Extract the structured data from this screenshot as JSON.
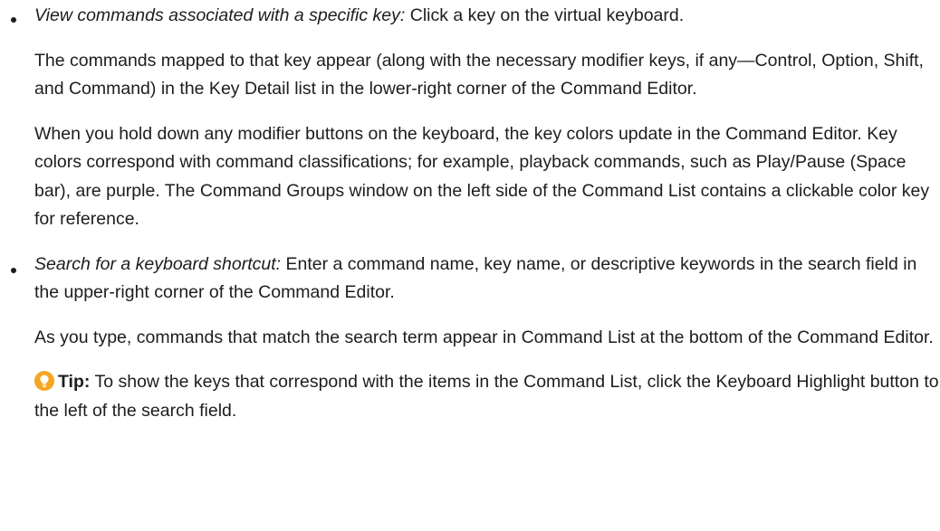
{
  "items": [
    {
      "term": "View commands associated with a specific key:",
      "lead": " Click a key on the virtual keyboard.",
      "paragraphs": [
        "The commands mapped to that key appear (along with the necessary modifier keys, if any—Control, Option, Shift, and Command) in the Key Detail list in the lower-right corner of the Command Editor.",
        "When you hold down any modifier buttons on the keyboard, the key colors update in the Command Editor. Key colors correspond with command classifications; for example, playback commands, such as Play/Pause (Space bar), are purple. The Command Groups window on the left side of the Command List contains a clickable color key for reference."
      ]
    },
    {
      "term": "Search for a keyboard shortcut:",
      "lead": " Enter a command name, key name, or descriptive keywords in the search field in the upper-right corner of the Command Editor.",
      "paragraphs": [
        "As you type, commands that match the search term appear in Command List at the bottom of the Command Editor."
      ],
      "tip": {
        "label": "Tip:",
        "text": " To show the keys that correspond with the items in the Command List, click the Keyboard Highlight button to the left of the search field.",
        "icon": "lightbulb-icon",
        "icon_color": "#f5a623"
      }
    }
  ]
}
